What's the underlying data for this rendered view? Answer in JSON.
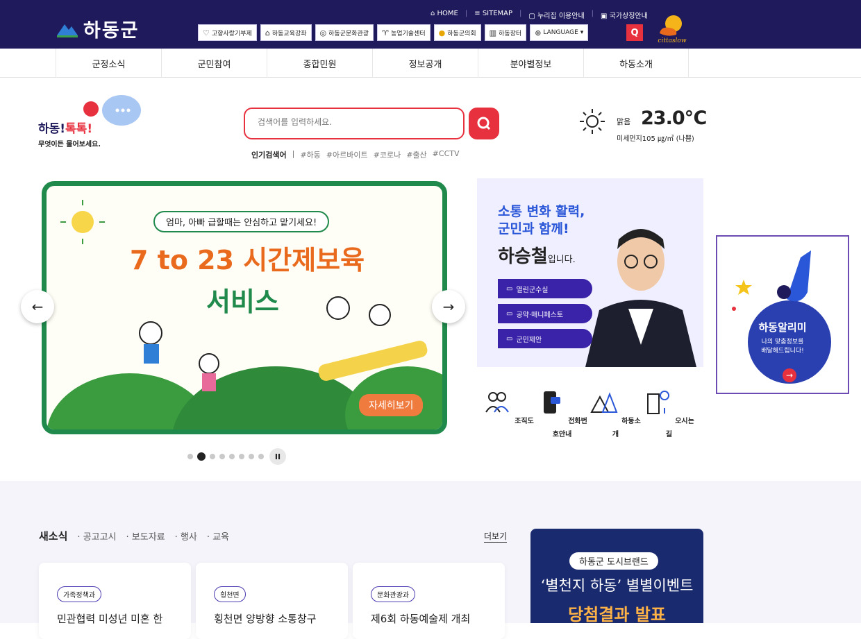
{
  "header": {
    "logo_text": "하동군",
    "utils": [
      "HOME",
      "SITEMAP",
      "누리집 이용안내",
      "국가상징안내"
    ],
    "quick": [
      {
        "label": "고향사랑기부제",
        "icon": "heart-icon"
      },
      {
        "label": "하동교육강좌",
        "icon": "building-icon"
      },
      {
        "label": "하동군문화관광",
        "icon": "location-pin-icon"
      },
      {
        "label": "농업기술센터",
        "icon": "sprout-icon"
      },
      {
        "label": "하동군의회",
        "icon": "council-icon"
      },
      {
        "label": "하동장터",
        "icon": "market-icon"
      },
      {
        "label": "LANGUAGE",
        "icon": "globe-icon"
      }
    ],
    "brand_badge": "cittaslow"
  },
  "nav": [
    "군정소식",
    "군민참여",
    "종합민원",
    "정보공개",
    "분야별정보",
    "하동소개"
  ],
  "talk": {
    "brand": "하동!",
    "highlight": "톡톡!",
    "tagline": "무엇이든 물어보세요."
  },
  "search": {
    "placeholder": "검색어를 입력하세요.",
    "popular_label": "인기검색어",
    "popular": [
      "#하동",
      "#아르바이트",
      "#코로나",
      "#출산",
      "#CCTV"
    ]
  },
  "weather": {
    "condition": "맑음",
    "temperature": "23.0℃",
    "dust": "미세먼지105 ㎍/㎥ (나쁨)"
  },
  "slider": {
    "subtitle": "엄마, 아빠 급할때는 안심하고 맡기세요!",
    "title1": "7 to 23 시간제보육",
    "title2": "서비스",
    "more": "자세히보기",
    "prev": "←",
    "next": "→",
    "dot_count": 8,
    "active_dot": 1,
    "pause": "II"
  },
  "mayor": {
    "slogan": "소통 변화 활력,",
    "slogan2": "군민과 함께!",
    "name": "하승철",
    "suffix": "입니다.",
    "pills": [
      "열린군수실",
      "공약·매니페스토",
      "군민제안"
    ]
  },
  "shortcuts": [
    "조직도",
    "전화번호안내",
    "하동소개",
    "오시는길"
  ],
  "alarm": {
    "title_a": "하",
    "title_b": "동알리미",
    "desc1": "나의 맞춤정보를",
    "desc2": "배달해드립니다!"
  },
  "news": {
    "tabs": [
      "새소식",
      "공고고시",
      "보도자료",
      "행사",
      "교육"
    ],
    "more": "더보기",
    "cards": [
      {
        "tag": "가족정책과",
        "title": "민관협력 미성년 미혼 한"
      },
      {
        "tag": "횡천면",
        "title": "횡천면 양방향 소통창구"
      },
      {
        "tag": "문화관광과",
        "title": "제6회 하동예술제 개최"
      }
    ]
  },
  "brand_banner": {
    "tag": "하동군 도시브랜드",
    "line1": "‘별천지 하동’ 별별이벤트",
    "line2": "당첨결과 발표"
  }
}
